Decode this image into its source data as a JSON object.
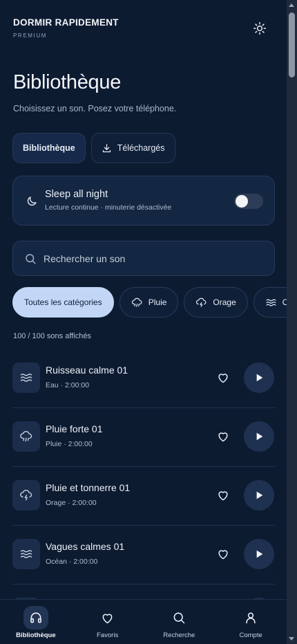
{
  "brand": {
    "name": "DORMIR RAPIDEMENT",
    "tier": "PREMIUM"
  },
  "header": {
    "theme_icon": "sun-icon"
  },
  "page": {
    "title": "Bibliothèque",
    "subtitle": "Choisissez un son. Posez votre téléphone."
  },
  "tabs": [
    {
      "label": "Bibliothèque",
      "icon": "",
      "active": true
    },
    {
      "label": "Téléchargés",
      "icon": "download-icon",
      "active": false
    }
  ],
  "sleep_card": {
    "title": "Sleep all night",
    "subtitle": "Lecture continue · minuterie désactivée",
    "icon": "moon-icon",
    "enabled": false
  },
  "search": {
    "placeholder": "Rechercher un son",
    "icon": "search-icon"
  },
  "categories": [
    {
      "label": "Toutes les catégories",
      "icon": "",
      "active": true
    },
    {
      "label": "Pluie",
      "icon": "rain-cloud-icon",
      "active": false
    },
    {
      "label": "Orage",
      "icon": "storm-cloud-icon",
      "active": false
    },
    {
      "label": "Oc",
      "icon": "waves-icon",
      "active": false
    }
  ],
  "count_text": "100 / 100 sons affichés",
  "sounds": [
    {
      "title": "Ruisseau calme 01",
      "meta": "Eau · 2:00:00",
      "icon": "waves-icon"
    },
    {
      "title": "Pluie forte 01",
      "meta": "Pluie · 2:00:00",
      "icon": "rain-cloud-icon"
    },
    {
      "title": "Pluie et tonnerre 01",
      "meta": "Orage · 2:00:00",
      "icon": "storm-cloud-icon"
    },
    {
      "title": "Vagues calmes 01",
      "meta": "Océan · 2:00:00",
      "icon": "waves-icon"
    }
  ],
  "bottom_nav": [
    {
      "label": "Bibliothèque",
      "icon": "headphones-icon",
      "active": true
    },
    {
      "label": "Favoris",
      "icon": "heart-icon",
      "active": false
    },
    {
      "label": "Recherche",
      "icon": "search-icon",
      "active": false
    },
    {
      "label": "Compte",
      "icon": "user-icon",
      "active": false
    }
  ],
  "colors": {
    "background": "#0d1b31",
    "card": "#132642",
    "accent_chip": "#c2d7f5",
    "text": "#e7ecf5"
  }
}
